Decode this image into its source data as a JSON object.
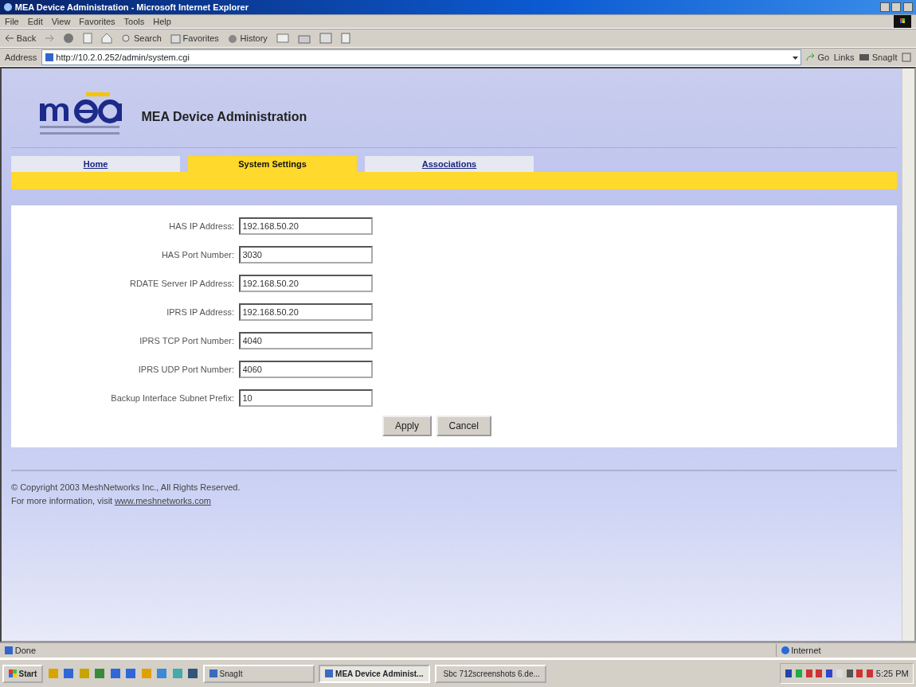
{
  "window": {
    "title": "MEA Device Administration - Microsoft Internet Explorer"
  },
  "menu": [
    "File",
    "Edit",
    "View",
    "Favorites",
    "Tools",
    "Help"
  ],
  "toolbar": {
    "back": "Back",
    "buttons": [
      "Search",
      "Favorites",
      "History"
    ]
  },
  "address_bar": {
    "label": "Address",
    "url": "http://10.2.0.252/admin/system.cgi",
    "go": "Go",
    "links": "Links",
    "snagit": "SnagIt"
  },
  "page": {
    "header_title": "MEA Device Administration",
    "tabs": [
      {
        "label": "Home",
        "selected": false
      },
      {
        "label": "System Settings",
        "selected": true
      },
      {
        "label": "Associations",
        "selected": false
      }
    ],
    "fields": [
      {
        "label": "HAS IP Address:",
        "value": "192.168.50.20"
      },
      {
        "label": "HAS Port Number:",
        "value": "3030"
      },
      {
        "label": "RDATE Server IP Address:",
        "value": "192.168.50.20"
      },
      {
        "label": "IPRS IP Address:",
        "value": "192.168.50.20"
      },
      {
        "label": "IPRS TCP Port Number:",
        "value": "4040"
      },
      {
        "label": "IPRS UDP Port Number:",
        "value": "4060"
      },
      {
        "label": "Backup Interface Subnet Prefix:",
        "value": "10"
      }
    ],
    "buttons": [
      "Apply",
      "Cancel"
    ],
    "copyright": "© Copyright 2003 MeshNetworks Inc., All Rights Reserved.",
    "more_info": "For more information, visit",
    "link": "www.meshnetworks.com"
  },
  "status_bar": {
    "text": "Done",
    "zone": "Internet"
  },
  "taskbar": {
    "start": "Start",
    "tasks": [
      {
        "label": "SnagIt",
        "selected": false
      },
      {
        "label": "MEA Device Administ...",
        "selected": true
      },
      {
        "label": "Sbc 712screenshots 6.de...",
        "selected": false
      }
    ],
    "clock": "5:25 PM"
  }
}
